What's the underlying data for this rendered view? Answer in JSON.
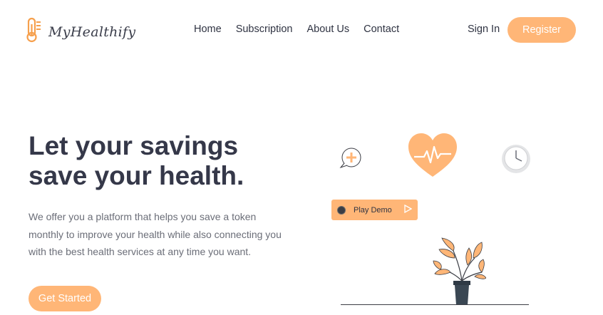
{
  "brand": {
    "name": "MyHealthify"
  },
  "nav": {
    "items": [
      "Home",
      "Subscription",
      "About Us",
      "Contact"
    ]
  },
  "auth": {
    "signin_label": "Sign In",
    "register_label": "Register"
  },
  "hero": {
    "headline": "Let your savings save your health.",
    "subtext": "We offer you a platform that helps you save a token monthly to improve your health while also connecting you with the best health services at any time you want.",
    "cta_label": "Get Started"
  },
  "illustration": {
    "play_demo_label": "Play Demo",
    "icons": [
      "chat-plus-icon",
      "heart-pulse-icon",
      "clock-icon",
      "potted-plant"
    ]
  },
  "colors": {
    "accent": "#ffb677",
    "heading": "#353849",
    "body_text": "#6b6e78",
    "dark": "#3b3d44"
  }
}
